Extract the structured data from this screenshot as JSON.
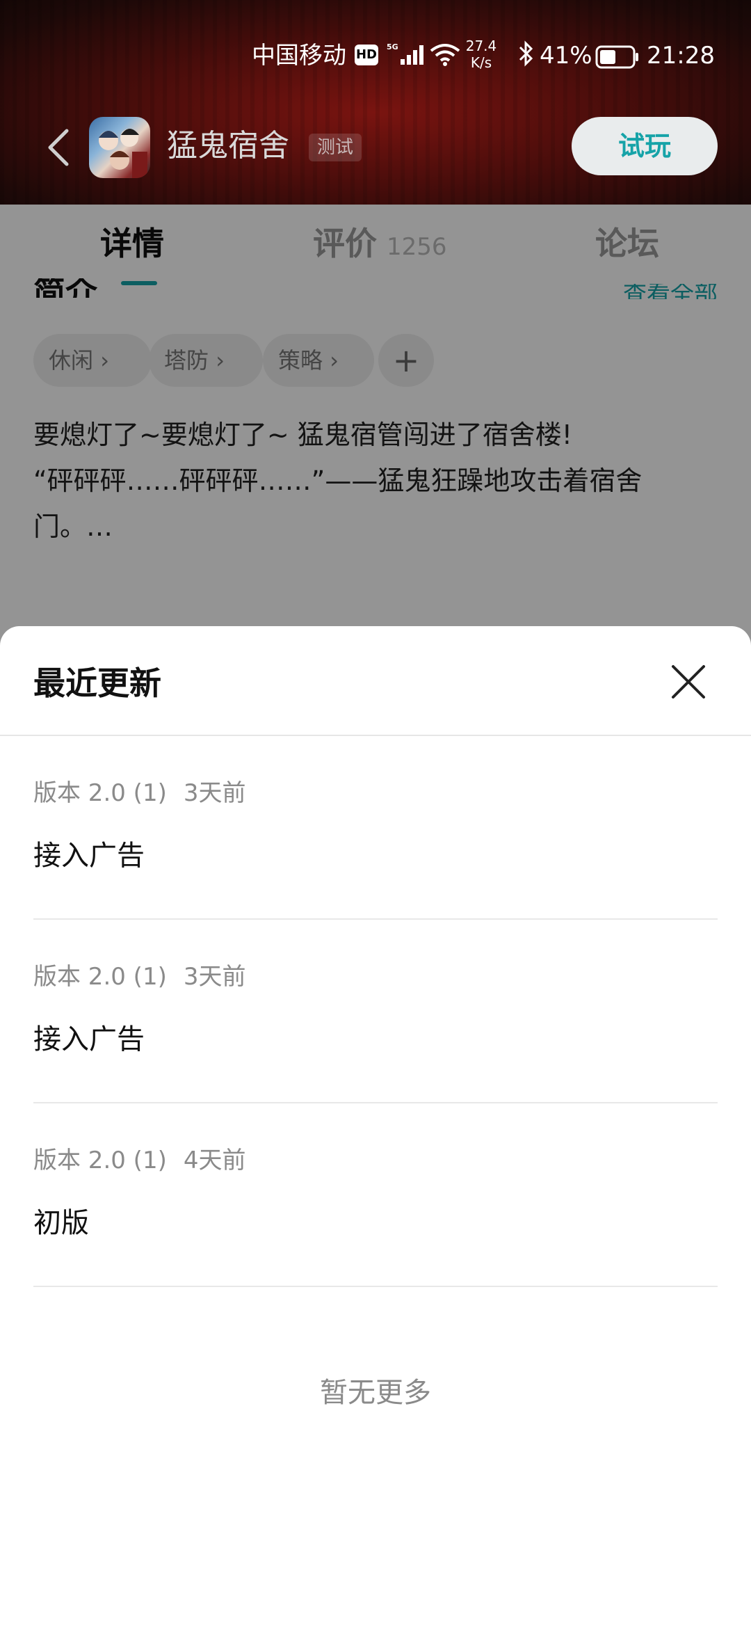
{
  "status_bar": {
    "carrier": "中国移动",
    "hd": "HD",
    "net_speed": "27.4\nK/s",
    "battery_percent": "41%",
    "time": "21:28"
  },
  "header": {
    "title": "猛鬼宿舍",
    "badge": "测试",
    "trial_button": "试玩"
  },
  "tabs": [
    {
      "label": "详情"
    },
    {
      "label": "评价",
      "count": "1256"
    },
    {
      "label": "论坛"
    }
  ],
  "intro": {
    "heading": "简介",
    "view_all": "查看全部",
    "tags": [
      "休闲",
      "塔防",
      "策略"
    ],
    "add_tag": "+",
    "description": "要熄灯了~要熄灯了~ 猛鬼宿管闯进了宿舍楼!\n“砰砰砰……砰砰砰……”——猛鬼狂躁地攻击着宿舍门。…"
  },
  "sheet": {
    "title": "最近更新",
    "updates": [
      {
        "version": "版本 2.0 (1)",
        "ago": "3天前",
        "text": "接入广告"
      },
      {
        "version": "版本 2.0 (1)",
        "ago": "3天前",
        "text": "接入广告"
      },
      {
        "version": "版本 2.0 (1)",
        "ago": "4天前",
        "text": "初版"
      }
    ],
    "footer": "暂无更多"
  },
  "colors": {
    "accent": "#16a3a8",
    "header_bg": "#4a0d0b"
  }
}
